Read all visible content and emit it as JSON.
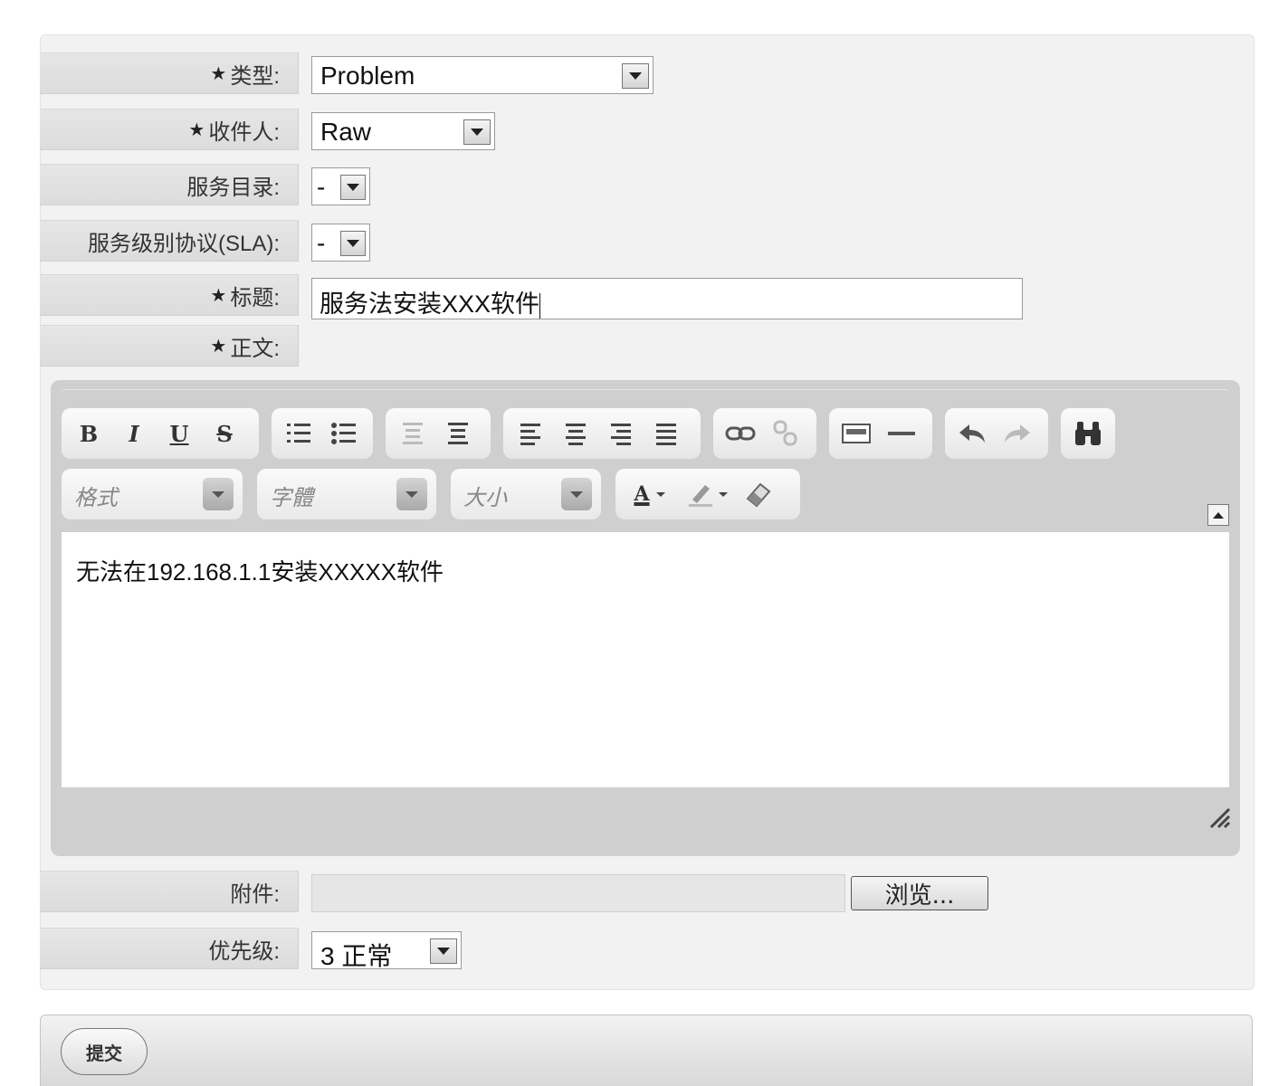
{
  "form": {
    "type": {
      "label": "类型:",
      "value": "Problem"
    },
    "recipient": {
      "label": "收件人:",
      "value": "Raw"
    },
    "service_catalog": {
      "label": "服务目录:",
      "value": "-"
    },
    "sla": {
      "label": "服务级别协议(SLA):",
      "value": "-"
    },
    "title": {
      "label": "标题:",
      "value": "服务法安装XXX软件"
    },
    "body": {
      "label": "正文:"
    },
    "attachment": {
      "label": "附件:",
      "browse_label": "浏览..."
    },
    "priority": {
      "label": "优先级:",
      "value": "3 正常"
    },
    "required_marker": "★"
  },
  "editor": {
    "toolbar": {
      "bold": "B",
      "italic": "I",
      "underline": "U",
      "strike": "S",
      "format_placeholder": "格式",
      "font_placeholder": "字體",
      "size_placeholder": "大小",
      "text_color": "A"
    },
    "content": "无法在192.168.1.1安装XXXXX软件"
  },
  "submit_label": "提交"
}
